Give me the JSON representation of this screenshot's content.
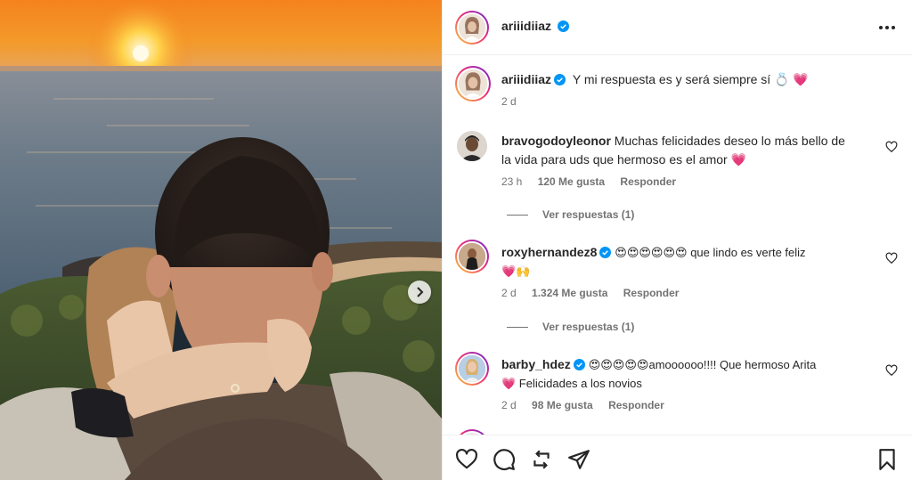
{
  "post_author": {
    "username": "ariiidiiaz",
    "verified": true
  },
  "caption": {
    "username": "ariiidiiaz",
    "text": "Y mi respuesta es y será siempre sí 💍 💗",
    "time": "2 d"
  },
  "comments": [
    {
      "username": "bravogodoyleonor",
      "verified": false,
      "text": "Muchas felicidades deseo lo más bello de la vida para uds que hermoso es el amor 💗",
      "line1": "Muchas felicidades deseo lo más bello de",
      "line2": "la vida para uds que hermoso es el amor 💗",
      "time": "23 h",
      "likes": "120 Me gusta",
      "reply": "Responder",
      "view_replies": "Ver respuestas (1)"
    },
    {
      "username": "roxyhernandez8",
      "verified": true,
      "line1": "😍😍😍😍😍😍 que lindo es verte feliz",
      "line2": "💗🙌",
      "time": "2 d",
      "likes": "1.324 Me gusta",
      "reply": "Responder",
      "view_replies": "Ver respuestas (1)"
    },
    {
      "username": "barby_hdez",
      "verified": true,
      "line1": "😍😍😍😍😍amoooooo!!!! Que hermoso Arita",
      "line2": "💗 Felicidades a los novios",
      "time": "2 d",
      "likes": "98 Me gusta",
      "reply": "Responder"
    }
  ],
  "icons": {
    "like": "heart-icon",
    "comment": "comment-icon",
    "share": "repost-icon",
    "send": "send-icon",
    "save": "bookmark-icon",
    "verified": "verified-badge-icon",
    "more": "more-options-icon",
    "next": "chevron-right-icon"
  },
  "colors": {
    "verified": "#0095f6",
    "muted": "#737373",
    "text": "#262626"
  }
}
